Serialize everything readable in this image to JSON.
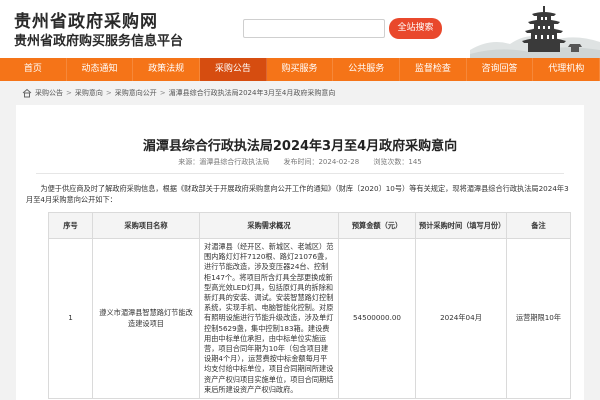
{
  "header": {
    "title": "贵州省政府采购网",
    "subtitle": "贵州省政府购买服务信息平台",
    "search_placeholder": "请输入关键字",
    "search_button": "全站搜索"
  },
  "nav": {
    "items": [
      "首页",
      "动态通知",
      "政策法规",
      "采购公告",
      "购买服务",
      "公共服务",
      "监督检查",
      "咨询回答",
      "代理机构"
    ],
    "active_index": 3
  },
  "breadcrumb": {
    "items": [
      "采购公告",
      "采购意向",
      "采购意向公开"
    ],
    "current": "湄潭县综合行政执法局2024年3月至4月政府采购意向"
  },
  "article": {
    "title": "湄潭县综合行政执法局2024年3月至4月政府采购意向",
    "source": "来源：湄潭县综合行政执法局",
    "date": "发布时间：2024-02-28",
    "views": "浏览次数：145",
    "intro": "为便于供应商及时了解政府采购信息，根据《财政部关于开展政府采购意向公开工作的通知》（财库〔2020〕10号）等有关规定，现将湄潭县综合行政执法局2024年3月至4月采购意向公开如下："
  },
  "table": {
    "headers": [
      "序号",
      "采购项目名称",
      "采购需求概况",
      "预算金额（元）",
      "预计采购时间（填写月份）",
      "备注"
    ],
    "rows": [
      {
        "index": "1",
        "name": "遵义市湄潭县智慧路灯节能改造建设项目",
        "desc": "对湄潭县（经开区、新城区、老城区）范围内路灯灯杆7120根、路灯21076盏，进行节能改造，涉及变压器24台、控制柜147个。将项目所含灯具全部更换成新型高光效LED灯具，包括原灯具的拆除和新灯具的安装、调试。安装智慧路灯控制系统，实现手机、电脑智能化控制。对原有照明设施进行节能升级改造，涉及单灯控制5629盏，集中控制183箱。建设费用由中标单位承担，由中标单位实施运营，项目合同年期为10年（包含项目建设期4个月），运营费按中标金额每月平均支付给中标单位，项目合同期间所建设资产产权归项目实施单位，项目合同期结束后所建设资产产权归政府。",
        "budget": "54500000.00",
        "time": "2024年04月",
        "remark": "运营期限10年"
      }
    ]
  },
  "colors": {
    "nav_bg": "#f57418",
    "nav_active": "#d64d10",
    "search_button": "#e9482c"
  },
  "icons": [
    "search-icon",
    "home-icon",
    "pagoda-logo"
  ]
}
